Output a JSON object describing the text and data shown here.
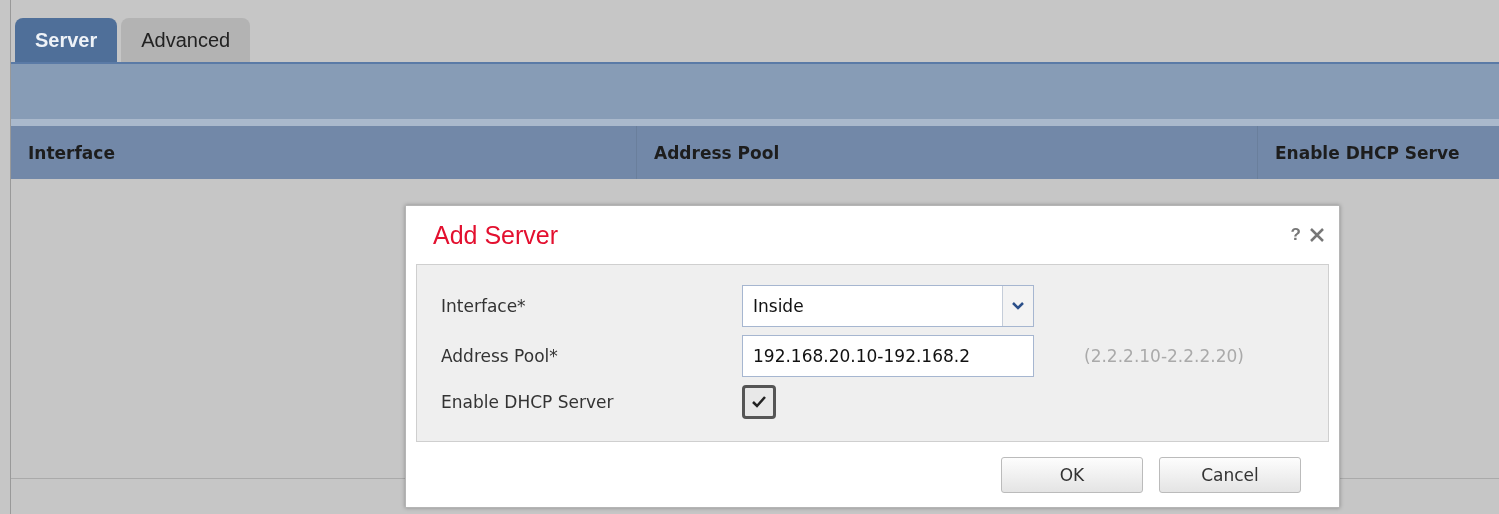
{
  "tabs": [
    {
      "label": "Server",
      "selected": true
    },
    {
      "label": "Advanced",
      "selected": false
    }
  ],
  "table": {
    "columns": [
      "Interface",
      "Address Pool",
      "Enable DHCP Serve"
    ]
  },
  "dialog": {
    "title": "Add Server",
    "help": "?",
    "fields": [
      {
        "kind": "select",
        "label": "Interface*",
        "value": "Inside"
      },
      {
        "kind": "text",
        "label": "Address Pool*",
        "value": "192.168.20.10-192.168.2",
        "hint": "(2.2.2.10-2.2.2.20)"
      },
      {
        "kind": "checkbox",
        "label": "Enable DHCP Server",
        "checked": true
      }
    ],
    "buttons": [
      "OK",
      "Cancel"
    ]
  }
}
